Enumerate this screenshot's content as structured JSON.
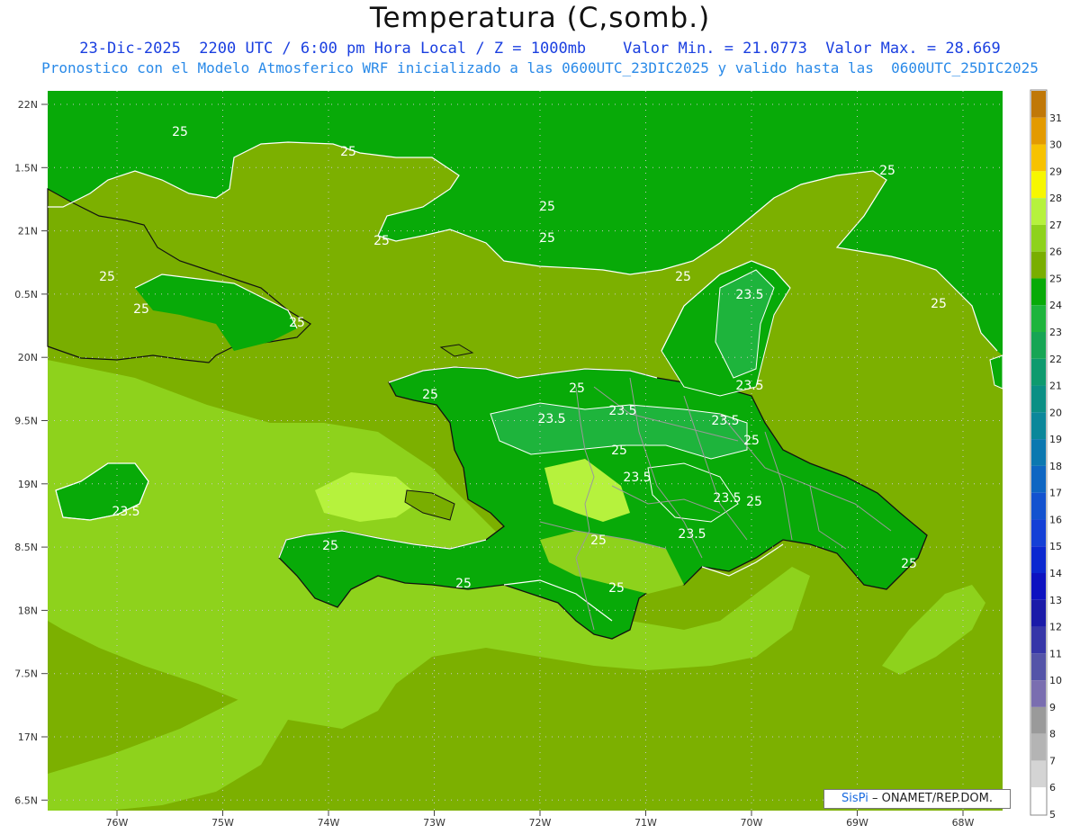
{
  "title": "Temperatura (C,somb.)",
  "subtitle_line1": "23-Dic-2025  2200 UTC / 6:00 pm Hora Local / Z = 1000mb    Valor Min. = 21.0773  Valor Max. = 28.669",
  "subtitle_line2": "Pronostico con el Modelo Atmosferico WRF inicializado a las 0600UTC_23DIC2025 y valido hasta las  0600UTC_25DIC2025",
  "credit": {
    "brand": "SisPi",
    "text": "– ONAMET/REP.DOM."
  },
  "lat_labels": [
    "22N",
    "1.5N",
    "21N",
    "0.5N",
    "20N",
    "9.5N",
    "19N",
    "8.5N",
    "18N",
    "7.5N",
    "17N",
    "6.5N"
  ],
  "lon_labels": [
    "76W",
    "75W",
    "74W",
    "73W",
    "72W",
    "71W",
    "70W",
    "69W",
    "68W"
  ],
  "legend": {
    "labels": [
      "31",
      "30",
      "29",
      "28",
      "27",
      "26",
      "25",
      "24",
      "23",
      "22",
      "21",
      "20",
      "19",
      "18",
      "17",
      "16",
      "15",
      "14",
      "13",
      "12",
      "11",
      "10",
      "9",
      "8",
      "7",
      "6",
      "5"
    ],
    "colors": [
      "#c07808",
      "#e39a00",
      "#f7c200",
      "#f7f700",
      "#b6f23d",
      "#8ed21c",
      "#79ae00",
      "#08aa08",
      "#1eb43c",
      "#16a554",
      "#0e9a6e",
      "#0b8f84",
      "#0b879a",
      "#0b78b0",
      "#0e66c2",
      "#1352cf",
      "#1440d6",
      "#0b28d0",
      "#0d12c0",
      "#1a1aa8",
      "#3636a8",
      "#5454a8",
      "#7a6eb0",
      "#9a9a9a",
      "#b4b4b4",
      "#d4d4d4",
      "#ffffff"
    ]
  },
  "contour_labels": [
    {
      "text": "25"
    },
    {
      "text": "25"
    },
    {
      "text": "25"
    },
    {
      "text": "25"
    },
    {
      "text": "25"
    },
    {
      "text": "25"
    },
    {
      "text": "25"
    },
    {
      "text": "25"
    },
    {
      "text": "25"
    },
    {
      "text": "25"
    },
    {
      "text": "25"
    },
    {
      "text": "25"
    },
    {
      "text": "25"
    },
    {
      "text": "25"
    },
    {
      "text": "25"
    },
    {
      "text": "25"
    },
    {
      "text": "25"
    },
    {
      "text": "25"
    },
    {
      "text": "25"
    },
    {
      "text": "25"
    },
    {
      "text": "25"
    },
    {
      "text": "23.5"
    },
    {
      "text": "23.5"
    },
    {
      "text": "23.5"
    },
    {
      "text": "23.5"
    },
    {
      "text": "23.5"
    },
    {
      "text": "23.5"
    },
    {
      "text": "23.5"
    },
    {
      "text": "23.5"
    },
    {
      "text": "23.5"
    }
  ]
}
